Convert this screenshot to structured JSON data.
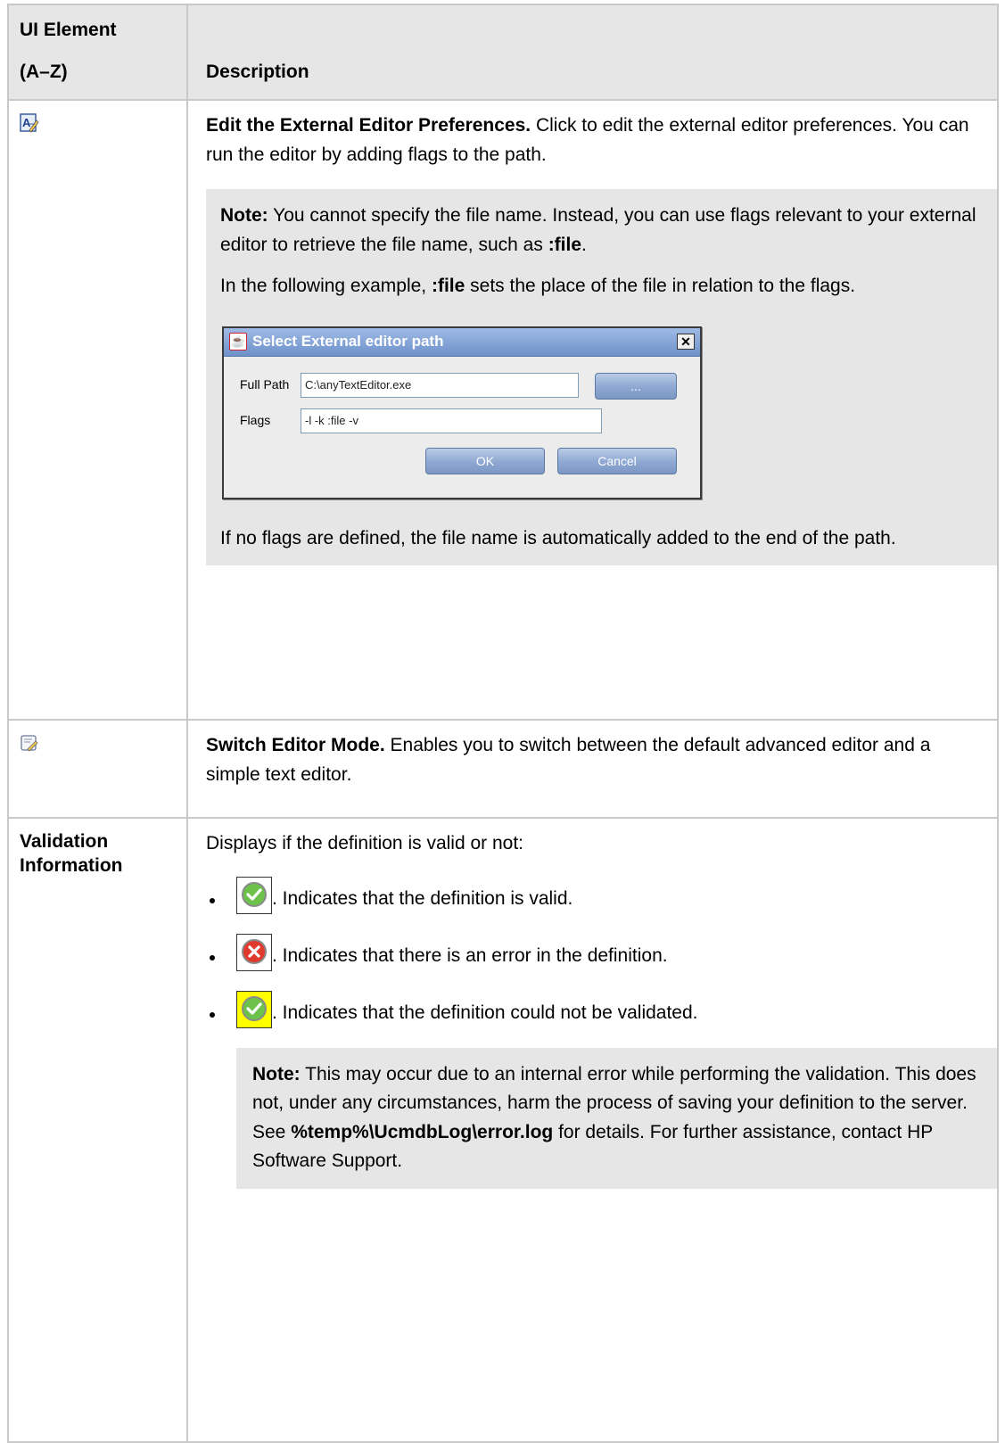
{
  "table": {
    "header": {
      "ui_element": "UI Element (A–Z)",
      "ui_element_line1": "UI Element",
      "ui_element_line2": "(A–Z)",
      "description": "Description"
    },
    "rows": [
      {
        "ui_icon": "edit-preferences-icon",
        "title": "Edit the External Editor Preferences.",
        "text": " Click to edit the external editor preferences. You can run the editor by adding flags to the path.",
        "note": {
          "label": "Note:",
          "p1_text": " You cannot specify the file name. Instead, you can use flags relevant to your external editor to retrieve the file name, such as ",
          "p1_bold": ":file",
          "p1_end": ".",
          "p2_pre": "In the following example, ",
          "p2_bold": ":file",
          "p2_post": " sets the place of the file in relation to the flags.",
          "p3": "If no flags are defined, the file name is automatically added to the end of the path."
        },
        "dialog": {
          "title": "Select External editor path",
          "full_path_label": "Full Path",
          "full_path_value": "C:\\anyTextEditor.exe",
          "flags_label": "Flags",
          "flags_value": "-l -k :file -v",
          "browse_label": "...",
          "ok_label": "OK",
          "cancel_label": "Cancel"
        }
      },
      {
        "ui_icon": "switch-editor-mode-icon",
        "title": "Switch Editor Mode.",
        "text": " Enables you to switch between the default advanced editor and a simple text editor."
      },
      {
        "ui_label_line1": "Validation",
        "ui_label_line2": "Information",
        "intro": "Displays if the definition is valid or not:",
        "items": [
          {
            "icon": "valid-check-icon",
            "text": ". Indicates that the definition is valid."
          },
          {
            "icon": "error-x-icon",
            "text": ". Indicates that there is an error in the definition."
          },
          {
            "icon": "not-validated-check-icon",
            "text": ". Indicates that the definition could not be validated."
          }
        ],
        "note": {
          "label": "Note:",
          "text1": " This may occur due to an internal error while performing the validation. This does not, under any circumstances, harm the process of saving your definition to the server. See ",
          "path": "%temp%\\UcmdbLog\\error.log",
          "text2": " for details. For further assistance, contact HP Software Support."
        }
      }
    ]
  },
  "colors": {
    "header_bg": "#e6e6e6",
    "note_bg": "#e6e6e6",
    "border": "#c9c9c9",
    "warn_bg": "#ffff00"
  }
}
